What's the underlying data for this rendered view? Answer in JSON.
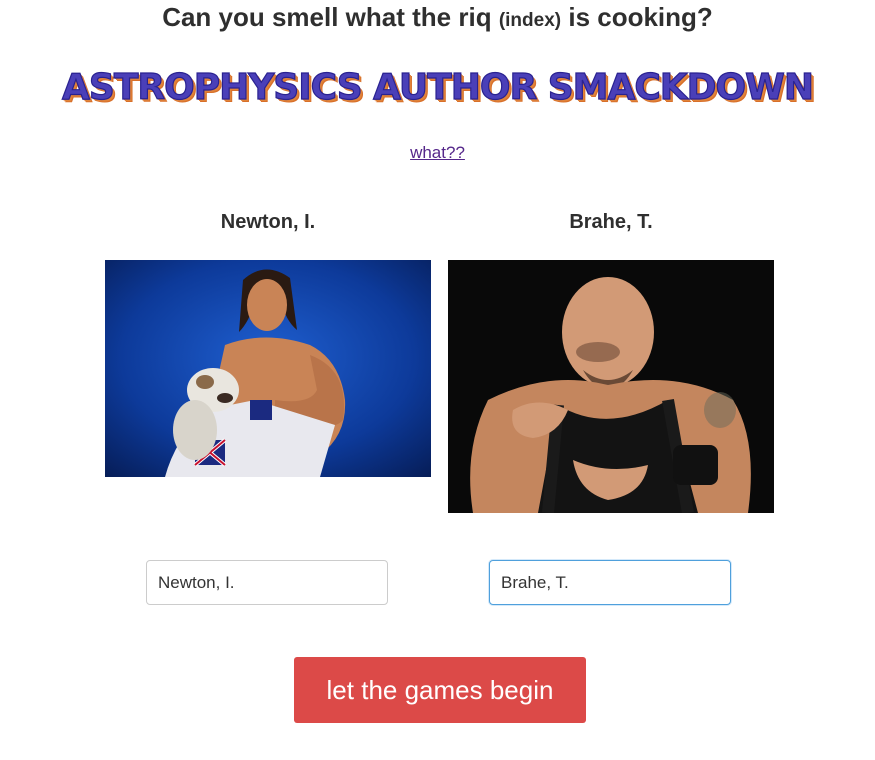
{
  "header": {
    "tagline_start": "Can you smell what the riq",
    "tagline_small": "(index)",
    "tagline_end": "is cooking?",
    "title": "ASTROPHYSICS AUTHOR SMACKDOWN",
    "help_link": "what??"
  },
  "fighters": [
    {
      "name": "Newton, I.",
      "input_value": "Newton, I."
    },
    {
      "name": "Brahe, T.",
      "input_value": "Brahe, T."
    }
  ],
  "actions": {
    "start_label": "let the games begin"
  },
  "colors": {
    "title_fill": "#4a3fb8",
    "title_shadow": "#e0833a",
    "button_bg": "#dc4a48",
    "focus_border": "#4fa0dc"
  }
}
